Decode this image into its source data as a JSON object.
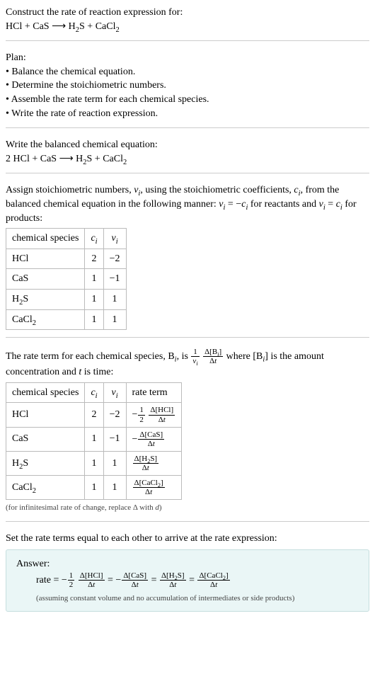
{
  "prompt": {
    "line1": "Construct the rate of reaction expression for:",
    "equation_html": "HCl + CaS  ⟶  H<sub>2</sub>S + CaCl<sub>2</sub>"
  },
  "plan": {
    "heading": "Plan:",
    "items": [
      "Balance the chemical equation.",
      "Determine the stoichiometric numbers.",
      "Assemble the rate term for each chemical species.",
      "Write the rate of reaction expression."
    ]
  },
  "balanced": {
    "heading": "Write the balanced chemical equation:",
    "equation_html": "2 HCl + CaS  ⟶  H<sub>2</sub>S + CaCl<sub>2</sub>"
  },
  "stoich_section": {
    "text_html": "Assign stoichiometric numbers, <span class='eq-i'>ν<sub>i</sub></span>, using the stoichiometric coefficients, <span class='eq-i'>c<sub>i</sub></span>, from the balanced chemical equation in the following manner: <span class='eq-i'>ν<sub>i</sub></span> = −<span class='eq-i'>c<sub>i</sub></span> for reactants and <span class='eq-i'>ν<sub>i</sub></span> = <span class='eq-i'>c<sub>i</sub></span> for products:",
    "headers": [
      "chemical species",
      "c_i",
      "ν_i"
    ],
    "rows": [
      {
        "species_html": "HCl",
        "c": "2",
        "nu": "−2"
      },
      {
        "species_html": "CaS",
        "c": "1",
        "nu": "−1"
      },
      {
        "species_html": "H<sub>2</sub>S",
        "c": "1",
        "nu": "1"
      },
      {
        "species_html": "CaCl<sub>2</sub>",
        "c": "1",
        "nu": "1"
      }
    ]
  },
  "rate_term_section": {
    "text_html": "The rate term for each chemical species, B<sub><span class='eq-i'>i</span></sub>, is <span class='frac'><span class='num'>1</span><span class='den'><span class='eq-i'>ν<sub>i</sub></span></span></span> <span class='frac'><span class='num'>Δ[B<sub><span class='eq-i'>i</span></sub>]</span><span class='den'>Δ<span class='eq-i'>t</span></span></span> where [B<sub><span class='eq-i'>i</span></sub>] is the amount concentration and <span class='eq-i'>t</span> is time:",
    "headers": [
      "chemical species",
      "c_i",
      "ν_i",
      "rate term"
    ],
    "rows": [
      {
        "species_html": "HCl",
        "c": "2",
        "nu": "−2",
        "rate_html": "−<span class='frac'><span class='num'>1</span><span class='den'>2</span></span> <span class='frac'><span class='num'>Δ[HCl]</span><span class='den'>Δ<span class='eq-i'>t</span></span></span>"
      },
      {
        "species_html": "CaS",
        "c": "1",
        "nu": "−1",
        "rate_html": "−<span class='frac'><span class='num'>Δ[CaS]</span><span class='den'>Δ<span class='eq-i'>t</span></span></span>"
      },
      {
        "species_html": "H<sub>2</sub>S",
        "c": "1",
        "nu": "1",
        "rate_html": "<span class='frac'><span class='num'>Δ[H<sub>2</sub>S]</span><span class='den'>Δ<span class='eq-i'>t</span></span></span>"
      },
      {
        "species_html": "CaCl<sub>2</sub>",
        "c": "1",
        "nu": "1",
        "rate_html": "<span class='frac'><span class='num'>Δ[CaCl<sub>2</sub>]</span><span class='den'>Δ<span class='eq-i'>t</span></span></span>"
      }
    ],
    "footnote_html": "(for infinitesimal rate of change, replace Δ with <span class='eq-i'>d</span>)"
  },
  "final": {
    "heading": "Set the rate terms equal to each other to arrive at the rate expression:",
    "answer_label": "Answer:",
    "rate_html": "rate = −<span class='frac'><span class='num'>1</span><span class='den'>2</span></span> <span class='frac'><span class='num'>Δ[HCl]</span><span class='den'>Δ<span class='eq-i'>t</span></span></span> = −<span class='frac'><span class='num'>Δ[CaS]</span><span class='den'>Δ<span class='eq-i'>t</span></span></span> = <span class='frac'><span class='num'>Δ[H<sub>2</sub>S]</span><span class='den'>Δ<span class='eq-i'>t</span></span></span> = <span class='frac'><span class='num'>Δ[CaCl<sub>2</sub>]</span><span class='den'>Δ<span class='eq-i'>t</span></span></span>",
    "assumption": "(assuming constant volume and no accumulation of intermediates or side products)"
  },
  "chart_data": {
    "type": "table",
    "stoichiometry_table": {
      "columns": [
        "chemical species",
        "c_i",
        "ν_i"
      ],
      "rows": [
        [
          "HCl",
          2,
          -2
        ],
        [
          "CaS",
          1,
          -1
        ],
        [
          "H2S",
          1,
          1
        ],
        [
          "CaCl2",
          1,
          1
        ]
      ]
    },
    "rate_term_table": {
      "columns": [
        "chemical species",
        "c_i",
        "ν_i",
        "rate term"
      ],
      "rows": [
        [
          "HCl",
          2,
          -2,
          "-(1/2) Δ[HCl]/Δt"
        ],
        [
          "CaS",
          1,
          -1,
          "-Δ[CaS]/Δt"
        ],
        [
          "H2S",
          1,
          1,
          "Δ[H2S]/Δt"
        ],
        [
          "CaCl2",
          1,
          1,
          "Δ[CaCl2]/Δt"
        ]
      ]
    }
  }
}
